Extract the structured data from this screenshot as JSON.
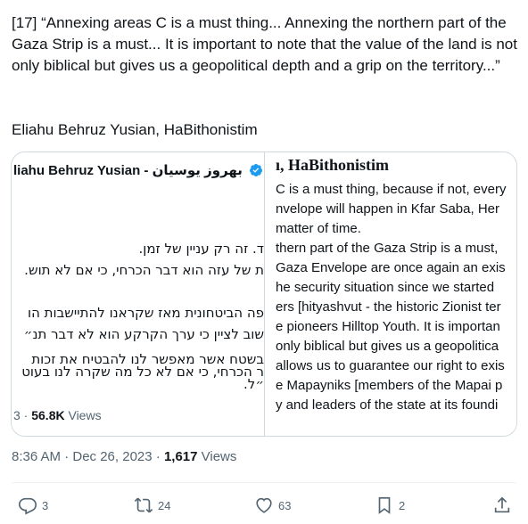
{
  "tweet": {
    "body": "[17] “Annexing areas C is a must thing... Annexing the northern part of the Gaza Strip is a must... It is important to note that the value of the land is not only biblical but gives us a geopolitical depth and a grip on the territory...”",
    "attribution": "Eliahu Behruz Yusian, HaBithonistim",
    "timestamp": "8:36 AM · Dec 26, 2023 · ",
    "views_count": "1,617",
    "views_label": " Views"
  },
  "embedded_left": {
    "author": "liahu Behruz Yusian - بهروز یوسیان",
    "hebrew_lines": [
      "ר הכרחי, כי אם לא כל מה שקרה לנו בעוט",
      "ד. זה רק עניין של זמן.",
      "ת של עזה הוא דבר הכרחי, כי אם לא תוש.",
      "פה הביטחונית מאז שקראנו להתיישבות הו",
      "שוב לציין כי ערך הקרקע הוא לא דבר תנ״",
      "בשטח אשר מאפשר לנו להבטיח את זכות",
      "״ל."
    ],
    "views_count": "56.8K",
    "views_label": " Views",
    "views_prefix": "3 · "
  },
  "embedded_right": {
    "title": "ı, HaBithonistim",
    "lines": [
      "C is a must thing, because if not, every",
      "nvelope will happen in Kfar Saba, Her",
      "matter of time.",
      "thern part of the Gaza Strip is a must,",
      "Gaza Envelope are once again an exis",
      "he security situation since we started",
      "ers [hityashvut - the historic Zionist ter",
      "e pioneers Hilltop Youth. It is importan",
      "only biblical but gives us a geopolitica",
      "allows us to guarantee our right to exis",
      "e Mapayniks [members of the Mapai p",
      "y and leaders of the state at its foundi"
    ]
  },
  "actions": {
    "reply_count": "3",
    "retweet_count": "24",
    "like_count": "63",
    "bookmark_count": "2"
  },
  "colors": {
    "text": "#0f1419",
    "secondary": "#536471",
    "border": "#cfd9de",
    "verified": "#1d9bf0"
  }
}
